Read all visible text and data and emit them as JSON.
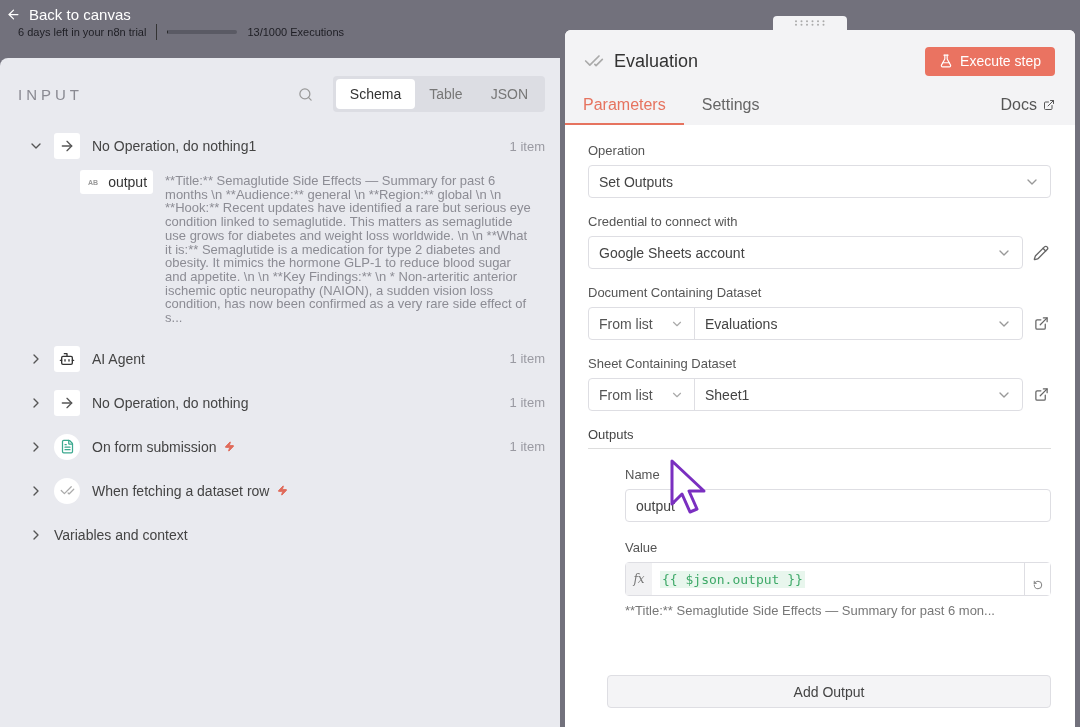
{
  "top_bar": {
    "back_link": "Back to canvas",
    "trial_notice": "6 days left in your n8n trial",
    "executions": {
      "level": 0.013,
      "label": "13/1000 Executions"
    }
  },
  "input_panel": {
    "title": "INPUT",
    "view_tabs": [
      {
        "label": "Schema",
        "selected": true
      },
      {
        "label": "Table",
        "selected": false
      },
      {
        "label": "JSON",
        "selected": false
      }
    ],
    "nodes": [
      {
        "kind": "noop",
        "label": "No Operation, do nothing1",
        "count": "1 item",
        "expanded": true,
        "trigger": false,
        "fields": [
          {
            "type_badge": "AB",
            "name": "output",
            "value": "**Title:** Semaglutide Side Effects — Summary for past 6 months \\n **Audience:** general \\n **Region:** global \\n \\n **Hook:** Recent updates have identified a rare but serious eye condition linked to semaglutide. This matters as semaglutide use grows for diabetes and weight loss worldwide. \\n \\n **What it is:** Semaglutide is a medication for type 2 diabetes and obesity. It mimics the hormone GLP-1 to reduce blood sugar and appetite. \\n \\n **Key Findings:** \\n * Non-arteritic anterior ischemic optic neuropathy (NAION), a sudden vision loss condition, has now been confirmed as a very rare side effect of s..."
          }
        ]
      },
      {
        "kind": "agent",
        "label": "AI Agent",
        "count": "1 item",
        "expanded": false,
        "trigger": false
      },
      {
        "kind": "noop",
        "label": "No Operation, do nothing",
        "count": "1 item",
        "expanded": false,
        "trigger": false
      },
      {
        "kind": "form",
        "label": "On form submission",
        "count": "1 item",
        "expanded": false,
        "trigger": true
      },
      {
        "kind": "evaluation",
        "label": "When fetching a dataset row",
        "expanded": false,
        "trigger": true
      }
    ],
    "variables": {
      "label": "Variables and context",
      "expanded": false
    }
  },
  "node_panel": {
    "title": "Evaluation",
    "execute_button": "Execute step",
    "tabs": [
      {
        "label": "Parameters",
        "selected": true
      },
      {
        "label": "Settings",
        "selected": false
      }
    ],
    "docs_link": "Docs",
    "parameters": [
      {
        "kind": "select",
        "label": "Operation",
        "value": "Set Outputs"
      },
      {
        "kind": "credential",
        "label": "Credential to connect with",
        "value": "Google Sheets account"
      },
      {
        "kind": "resource",
        "label": "Document Containing Dataset",
        "mode": "From list",
        "value": "Evaluations"
      },
      {
        "kind": "resource",
        "label": "Sheet Containing Dataset",
        "mode": "From list",
        "value": "Sheet1"
      }
    ],
    "outputs": {
      "title": "Outputs",
      "name_label": "Name",
      "name_value": "output",
      "value_label": "Value",
      "fx_label": "fx",
      "expression": "{{ $json.output }}",
      "preview": "**Title:** Semaglutide Side Effects — Summary for past 6 mon...",
      "add_button": "Add Output"
    }
  }
}
